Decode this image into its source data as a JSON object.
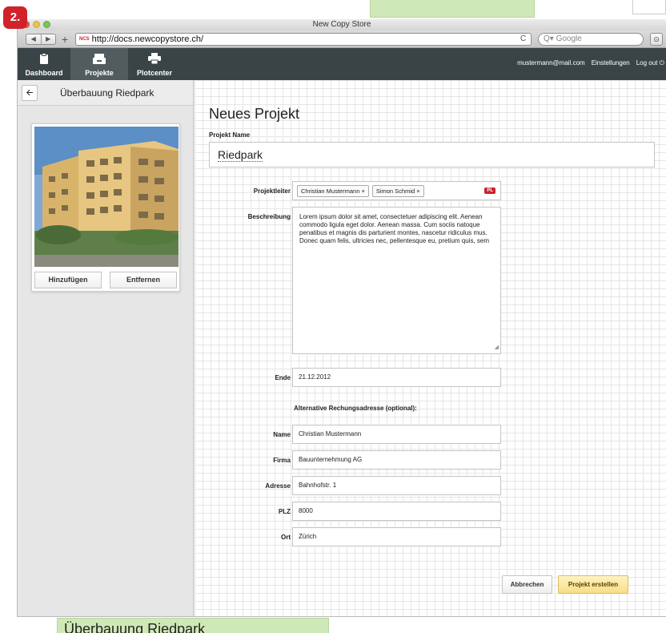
{
  "step_badge": "2.",
  "window": {
    "title": "New Copy Store"
  },
  "browser": {
    "url": "http://docs.newcopystore.ch/",
    "favicon": "NCS",
    "search_placeholder": "Google",
    "search_prefix": "Q▾",
    "back_icon": "◀",
    "forward_icon": "▶",
    "plus_icon": "+",
    "reload_icon": "C"
  },
  "nav": {
    "items": [
      {
        "label": "Dashboard",
        "icon": "clipboard-icon",
        "active": false
      },
      {
        "label": "Projekte",
        "icon": "drawer-icon",
        "active": true
      },
      {
        "label": "Plotcenter",
        "icon": "printer-icon",
        "active": false
      }
    ],
    "user_email": "mustermann@mail.com",
    "settings_label": "Einstellungen",
    "logout_label": "Log out"
  },
  "sidebar": {
    "back_icon": "arrow-left-icon",
    "title": "Überbauung Riedpark",
    "add_label": "Hinzufügen",
    "remove_label": "Entfernen"
  },
  "form": {
    "page_title": "Neues Projekt",
    "project_name_label": "Projekt Name",
    "project_name_value": "Riedpark",
    "projektleiter_label": "Projektleiter",
    "projektleiter_tags": [
      "Christian Mustermann",
      "Simon Schmid"
    ],
    "tag_remove_symbol": "×",
    "pl_badge": "PL",
    "beschreibung_label": "Beschreibung",
    "beschreibung_value": "Lorem ipsum dolor sit amet, consectetuer adipiscing elit. Aenean commodo ligula eget dolor. Aenean massa. Cum sociis natoque penatibus et magnis dis parturient montes, nascetur ridiculus mus. Donec quam felis, ultricies nec, pellentesque eu, pretium quis, sem",
    "ende_label": "Ende",
    "ende_value": "21.12.2012",
    "alt_heading": "Alternative Rechungsadresse (optional):",
    "name_label": "Name",
    "name_value": "Christian Mustermann",
    "firma_label": "Firma",
    "firma_value": "Bauunternehmung AG",
    "adresse_label": "Adresse",
    "adresse_value": "Bahnhofstr. 1",
    "plz_label": "PLZ",
    "plz_value": "8000",
    "ort_label": "Ort",
    "ort_value": "Zürich",
    "cancel_label": "Abbrechen",
    "create_label": "Projekt erstellen"
  },
  "bottom_overlay": "Überbauung Riedpark",
  "colors": {
    "navbar": "#3a4447",
    "badge_red": "#d1222a",
    "create_button": "#f6de86",
    "annotation_green": "#cfe8b7"
  }
}
